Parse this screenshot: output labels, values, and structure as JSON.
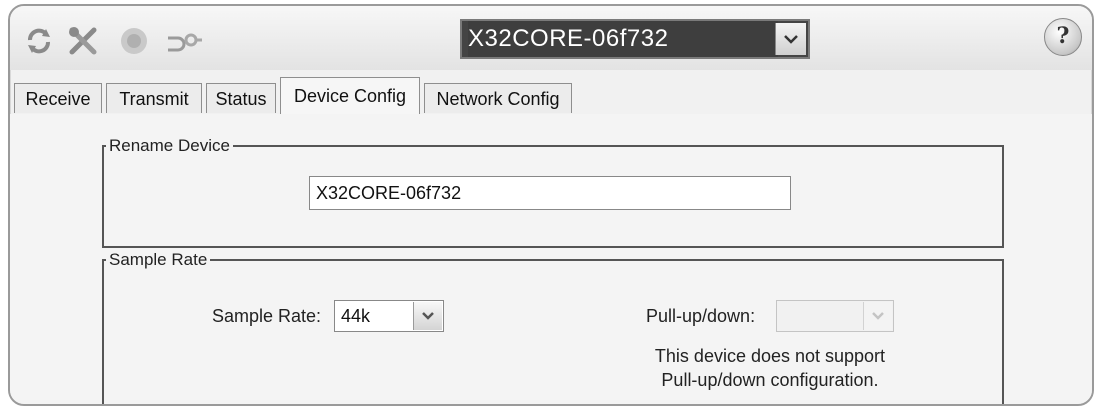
{
  "toolbar": {
    "icons": [
      "refresh-icon",
      "tools-icon",
      "record-icon",
      "network-icon"
    ],
    "device_selector": {
      "value": "X32CORE-06f732"
    },
    "help_label": "?"
  },
  "tabs": [
    {
      "label": "Receive",
      "active": false
    },
    {
      "label": "Transmit",
      "active": false
    },
    {
      "label": "Status",
      "active": false
    },
    {
      "label": "Device Config",
      "active": true
    },
    {
      "label": "Network Config",
      "active": false
    }
  ],
  "rename_device": {
    "title": "Rename Device",
    "value": "X32CORE-06f732"
  },
  "sample_rate": {
    "title": "Sample Rate",
    "sample_rate_label": "Sample Rate:",
    "sample_rate_value": "44k",
    "pullup_label": "Pull-up/down:",
    "pullup_value": "",
    "note_line1": "This device does not support",
    "note_line2": "Pull-up/down configuration."
  }
}
